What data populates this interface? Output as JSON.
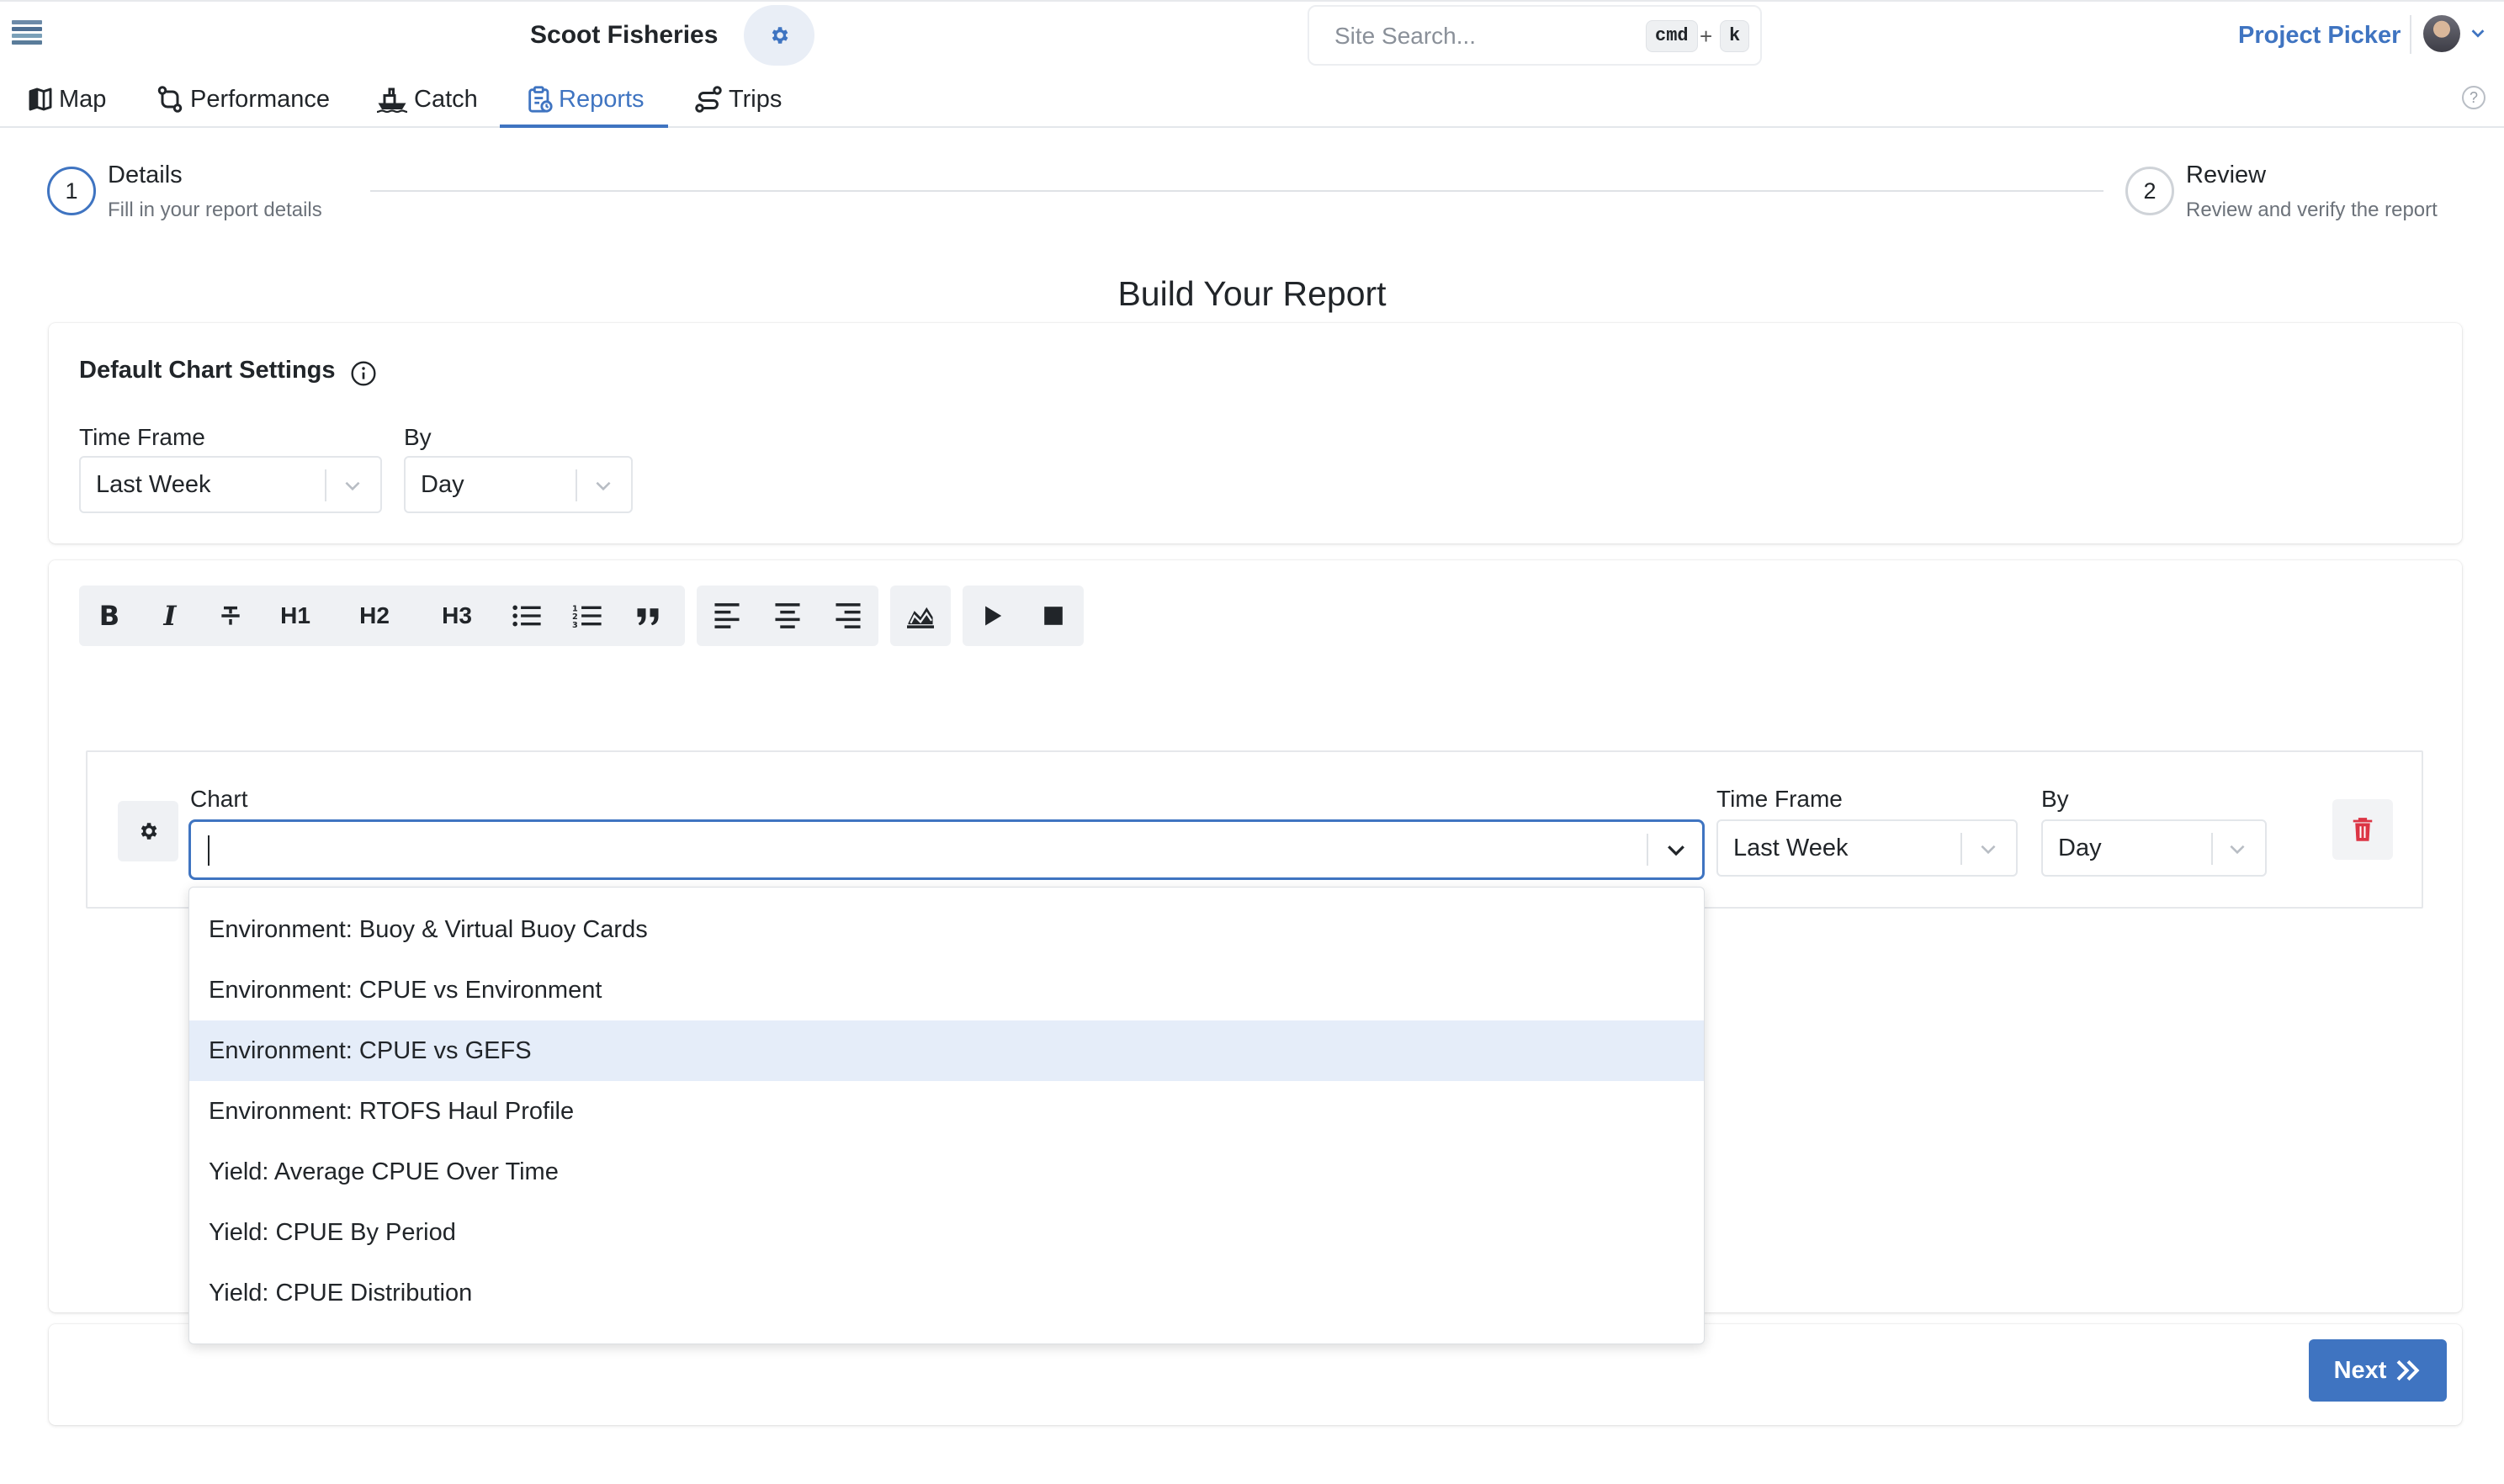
{
  "header": {
    "org_name": "Scoot Fisheries",
    "search_placeholder": "Site Search...",
    "shortcut_key1": "cmd",
    "shortcut_plus": "+",
    "shortcut_key2": "k",
    "project_picker": "Project Picker"
  },
  "nav": {
    "items": [
      {
        "label": "Map",
        "icon": "map-icon"
      },
      {
        "label": "Performance",
        "icon": "route-icon"
      },
      {
        "label": "Catch",
        "icon": "boat-icon"
      },
      {
        "label": "Reports",
        "icon": "clipboard-icon"
      },
      {
        "label": "Trips",
        "icon": "trips-icon"
      }
    ],
    "active": "Reports"
  },
  "stepper": {
    "step1_number": "1",
    "step1_title": "Details",
    "step1_sub": "Fill in your report details",
    "step2_number": "2",
    "step2_title": "Review",
    "step2_sub": "Review and verify the report"
  },
  "page_title": "Build Your Report",
  "default_settings": {
    "title": "Default Chart Settings",
    "time_frame_label": "Time Frame",
    "time_frame_value": "Last Week",
    "by_label": "By",
    "by_value": "Day"
  },
  "toolbar": {
    "bold": "B",
    "italic": "I",
    "h1": "H1",
    "h2": "H2",
    "h3": "H3"
  },
  "chart_block": {
    "chart_label": "Chart",
    "chart_value": "",
    "time_frame_label": "Time Frame",
    "time_frame_value": "Last Week",
    "by_label": "By",
    "by_value": "Day",
    "options": [
      "Environment: Buoy & Virtual Buoy Cards",
      "Environment: CPUE vs Environment",
      "Environment: CPUE vs GEFS",
      "Environment: RTOFS Haul Profile",
      "Yield: Average CPUE Over Time",
      "Yield: CPUE By Period",
      "Yield: CPUE Distribution"
    ],
    "highlighted_option": "Environment: CPUE vs GEFS"
  },
  "footer": {
    "next_label": "Next"
  },
  "colors": {
    "accent": "#3f74c1",
    "highlight": "#e5edf9",
    "danger": "#dc3545"
  }
}
